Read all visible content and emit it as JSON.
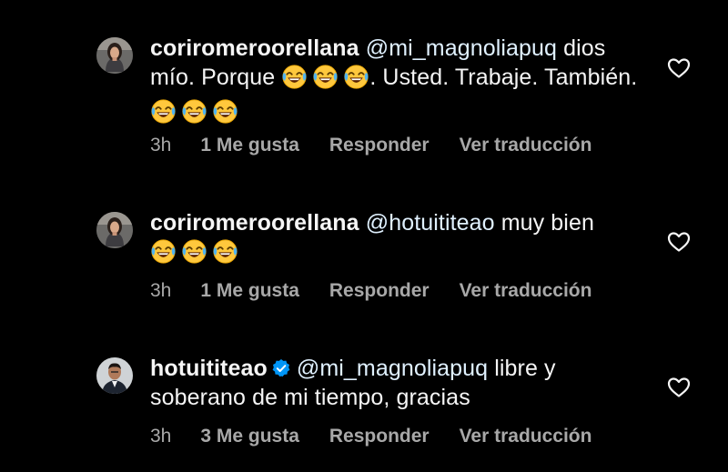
{
  "colors": {
    "background": "#000000",
    "text": "#f5f5f5",
    "meta": "#a8a8a8",
    "mention": "#e0f1ff",
    "verified": "#0095f6"
  },
  "comments": [
    {
      "avatar_icon": "avatar-woman-icon",
      "username": "coriromeroorellana",
      "mention": "@mi_magnoliapuq",
      "text_part1": " dios mío.  Porque ",
      "emoji_1": "face-with-tears-of-joy-emoji",
      "text_part2": ". Usted. Trabaje. También. ",
      "emoji_2": "face-with-tears-of-joy-emoji",
      "time": "3h",
      "likes": "1 Me gusta",
      "reply": "Responder",
      "translate": "Ver traducción",
      "like_icon": "heart-outline-icon"
    },
    {
      "avatar_icon": "avatar-woman-icon",
      "username": "coriromeroorellana",
      "mention": "@hotuititeao",
      "text_part1": " muy bien ",
      "emoji_1": "face-with-tears-of-joy-emoji",
      "time": "3h",
      "likes": "1 Me gusta",
      "reply": "Responder",
      "translate": "Ver traducción",
      "like_icon": "heart-outline-icon"
    },
    {
      "avatar_icon": "avatar-man-icon",
      "username": "hotuititeao",
      "verified_icon": "verified-badge-icon",
      "mention": "@mi_magnoliapuq",
      "text_part1": " libre y soberano de mi tiempo, gracias",
      "time": "3h",
      "likes": "3 Me gusta",
      "reply": "Responder",
      "translate": "Ver traducción",
      "like_icon": "heart-outline-icon"
    }
  ]
}
